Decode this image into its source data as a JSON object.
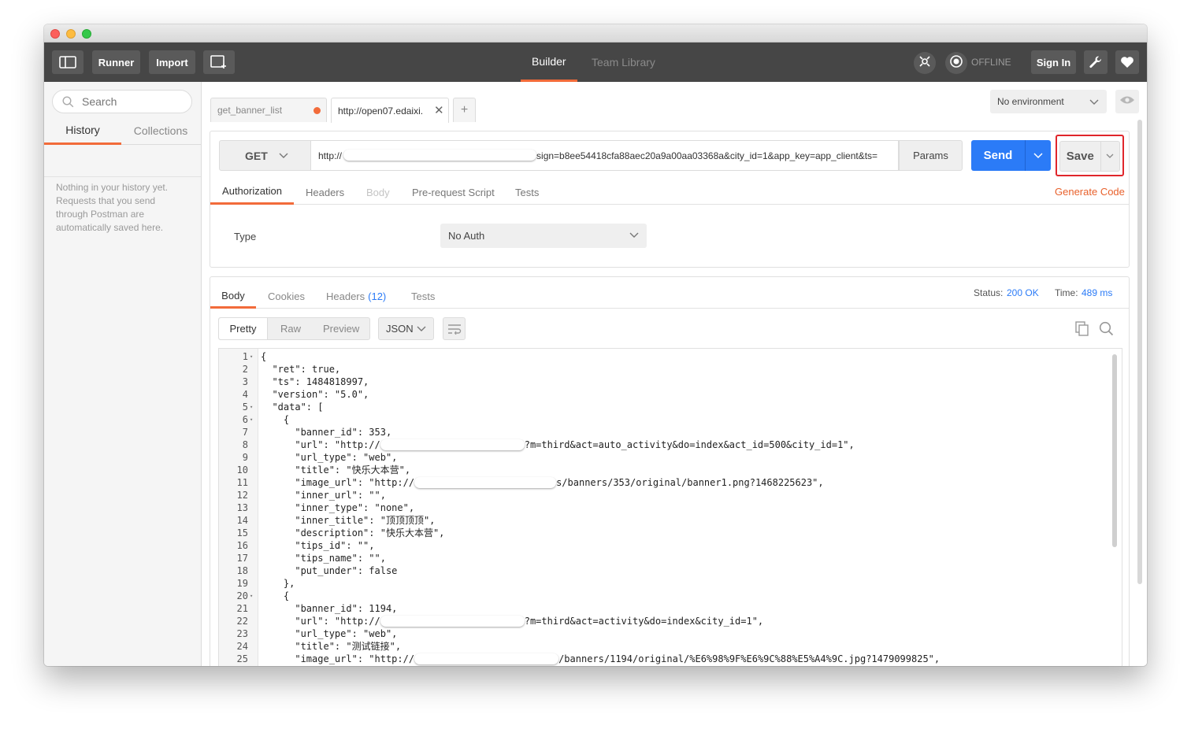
{
  "window": {
    "traffic_lights": [
      "close",
      "minimize",
      "zoom"
    ]
  },
  "header": {
    "sidebar_toggle_icon": "sidebar-toggle-icon",
    "runner_label": "Runner",
    "import_label": "Import",
    "new_window_icon": "new-window-icon",
    "tabs": [
      {
        "label": "Builder",
        "active": true
      },
      {
        "label": "Team Library",
        "active": false
      }
    ],
    "sync_icon": "interceptor-icon",
    "status_icon": "sync-status-icon",
    "offline_label": "OFFLINE",
    "signin_label": "Sign In",
    "settings_icon": "wrench-icon",
    "favorite_icon": "heart-icon",
    "accent": "#f26b3a"
  },
  "sidebar": {
    "search_placeholder": "Search",
    "tabs": [
      {
        "label": "History",
        "active": true
      },
      {
        "label": "Collections",
        "active": false
      }
    ],
    "empty_text": "Nothing in your history yet. Requests that you send through Postman are automatically saved here."
  },
  "request_tabs": [
    {
      "label": "get_banner_list",
      "unsaved": true,
      "active": false
    },
    {
      "label": "http://open07.edaixi.",
      "active": true
    }
  ],
  "environment": {
    "selected": "No environment"
  },
  "request": {
    "method": "GET",
    "url_prefix": "http://",
    "url_suffix": "sign=b8ee54418cfa88aec20a9a00aa03368a&city_id=1&app_key=app_client&ts=",
    "params_label": "Params",
    "send_label": "Send",
    "save_label": "Save",
    "generate_code_label": "Generate Code",
    "tabs": [
      {
        "label": "Authorization",
        "active": true,
        "disabled": false
      },
      {
        "label": "Headers",
        "active": false,
        "disabled": false
      },
      {
        "label": "Body",
        "active": false,
        "disabled": true
      },
      {
        "label": "Pre-request Script",
        "active": false,
        "disabled": false
      },
      {
        "label": "Tests",
        "active": false,
        "disabled": false
      }
    ],
    "auth_type_label": "Type",
    "auth_type_value": "No Auth"
  },
  "response": {
    "tabs": [
      {
        "label": "Body",
        "active": true
      },
      {
        "label": "Cookies",
        "active": false
      },
      {
        "label": "Headers",
        "count": "(12)",
        "active": false
      },
      {
        "label": "Tests",
        "active": false
      }
    ],
    "status_label": "Status:",
    "status_value": "200 OK",
    "time_label": "Time:",
    "time_value": "489 ms",
    "formats": [
      "Pretty",
      "Raw",
      "Preview"
    ],
    "active_format": "Pretty",
    "language": "JSON",
    "copy_icon": "copy-icon",
    "search_icon": "search-icon",
    "lines": [
      {
        "n": "1",
        "text": "{",
        "fold": true
      },
      {
        "n": "2",
        "text": "  \"ret\": true,"
      },
      {
        "n": "3",
        "text": "  \"ts\": 1484818997,"
      },
      {
        "n": "4",
        "text": "  \"version\": \"5.0\","
      },
      {
        "n": "5",
        "text": "  \"data\": [",
        "fold": true
      },
      {
        "n": "6",
        "text": "    {",
        "fold": true
      },
      {
        "n": "7",
        "text": "      \"banner_id\": 353,"
      },
      {
        "n": "8",
        "pre": "      \"url\": \"http://",
        "post": "?m=third&act=auto_activity&do=index&act_id=500&city_id=1\",",
        "redact_w": 183
      },
      {
        "n": "9",
        "text": "      \"url_type\": \"web\","
      },
      {
        "n": "10",
        "text": "      \"title\": \"快乐大本营\","
      },
      {
        "n": "11",
        "pre": "      \"image_url\": \"http://",
        "post": "s/banners/353/original/banner1.png?1468225623\",",
        "redact_w": 180
      },
      {
        "n": "12",
        "text": "      \"inner_url\": \"\","
      },
      {
        "n": "13",
        "text": "      \"inner_type\": \"none\","
      },
      {
        "n": "14",
        "text": "      \"inner_title\": \"顶顶顶顶\","
      },
      {
        "n": "15",
        "text": "      \"description\": \"快乐大本营\","
      },
      {
        "n": "16",
        "text": "      \"tips_id\": \"\","
      },
      {
        "n": "17",
        "text": "      \"tips_name\": \"\","
      },
      {
        "n": "18",
        "text": "      \"put_under\": false"
      },
      {
        "n": "19",
        "text": "    },"
      },
      {
        "n": "20",
        "text": "    {",
        "fold": true
      },
      {
        "n": "21",
        "text": "      \"banner_id\": 1194,"
      },
      {
        "n": "22",
        "pre": "      \"url\": \"http://",
        "post": "?m=third&act=activity&do=index&city_id=1\",",
        "redact_w": 183
      },
      {
        "n": "23",
        "text": "      \"url_type\": \"web\","
      },
      {
        "n": "24",
        "text": "      \"title\": \"测试链接\","
      },
      {
        "n": "25",
        "pre": "      \"image_url\": \"http://",
        "post": "/banners/1194/original/%E6%98%9F%E6%9C%88%E5%A4%9C.jpg?1479099825\",",
        "redact_w": 183
      }
    ]
  }
}
